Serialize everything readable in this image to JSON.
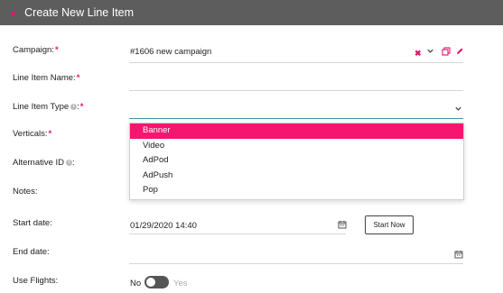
{
  "header": {
    "title": "Create New Line Item"
  },
  "form": {
    "campaign": {
      "label": "Campaign:",
      "value": "#1606 new campaign"
    },
    "line_item_name": {
      "label": "Line Item Name:",
      "value": ""
    },
    "line_item_type": {
      "label": "Line Item Type",
      "label_suffix": ":",
      "value": ""
    },
    "verticals": {
      "label": "Verticals:"
    },
    "alternative_id": {
      "label": "Alternative ID",
      "label_suffix": ":"
    },
    "notes": {
      "label": "Notes:"
    },
    "start_date": {
      "label": "Start date:",
      "value": "01/29/2020 14:40",
      "button": "Start Now"
    },
    "end_date": {
      "label": "End date:",
      "value": ""
    },
    "use_flights": {
      "label": "Use Flights:",
      "off_label": "No",
      "on_label": "Yes",
      "state": "off"
    }
  },
  "type_dropdown": {
    "options": [
      "Banner",
      "Video",
      "AdPod",
      "AdPush",
      "Pop"
    ],
    "selected": "Banner"
  },
  "colors": {
    "accent": "#e3156b",
    "selected_bg": "#f5166f",
    "header_bg": "#5d5d5d"
  },
  "icons": {
    "header_caret": "caret-right-icon",
    "clear": "close-icon",
    "chevron": "chevron-down-icon",
    "copy": "copy-icon",
    "edit": "pencil-icon",
    "calendar": "calendar-icon",
    "info": "info-icon"
  }
}
